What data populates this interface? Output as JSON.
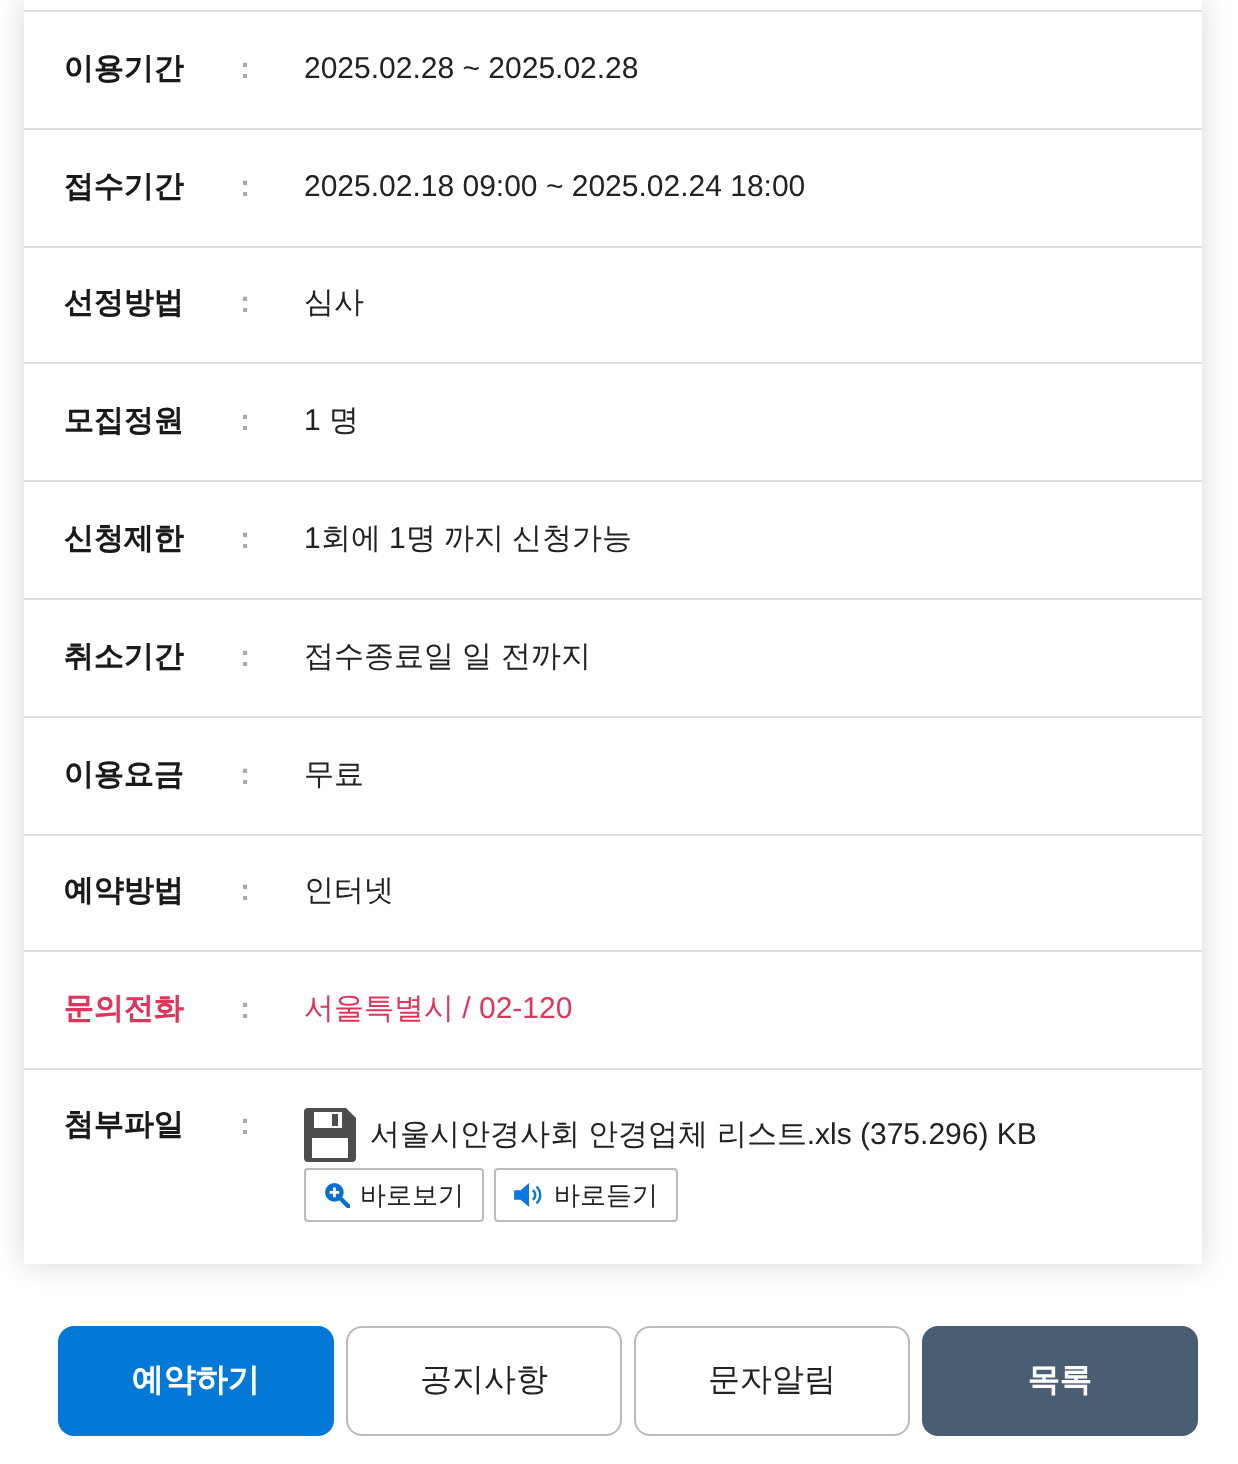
{
  "details": [
    {
      "kind": "text",
      "label": "이용기간",
      "separator": ":",
      "value": "2025.02.28 ~ 2025.02.28",
      "highlighted": false
    },
    {
      "kind": "text",
      "label": "접수기간",
      "separator": ":",
      "value": "2025.02.18 09:00 ~ 2025.02.24 18:00",
      "highlighted": false
    },
    {
      "kind": "text",
      "label": "선정방법",
      "separator": ":",
      "value": "심사",
      "highlighted": false
    },
    {
      "kind": "text",
      "label": "모집정원",
      "separator": ":",
      "value": "1 명",
      "highlighted": false
    },
    {
      "kind": "text",
      "label": "신청제한",
      "separator": ":",
      "value": "1회에 1명 까지 신청가능",
      "highlighted": false
    },
    {
      "kind": "text",
      "label": "취소기간",
      "separator": ":",
      "value": "접수종료일 일 전까지",
      "highlighted": false
    },
    {
      "kind": "text",
      "label": "이용요금",
      "separator": ":",
      "value": "무료",
      "highlighted": false
    },
    {
      "kind": "text",
      "label": "예약방법",
      "separator": ":",
      "value": "인터넷",
      "highlighted": false
    },
    {
      "kind": "text",
      "label": "문의전화",
      "separator": ":",
      "value": "서울특별시 / 02-120",
      "highlighted": true
    },
    {
      "kind": "file",
      "label": "첨부파일",
      "separator": ":",
      "file_name": "서울시안경사회 안경업체 리스트.xls (375.296) KB",
      "highlighted": false,
      "file_buttons": [
        {
          "kind": "view",
          "label": "바로보기"
        },
        {
          "kind": "listen",
          "label": "바로듣기"
        }
      ]
    }
  ],
  "actions": [
    {
      "kind": "primary",
      "label": "예약하기"
    },
    {
      "kind": "outline",
      "label": "공지사항"
    },
    {
      "kind": "outline",
      "label": "문자알림"
    },
    {
      "kind": "dark",
      "label": "목록"
    }
  ]
}
